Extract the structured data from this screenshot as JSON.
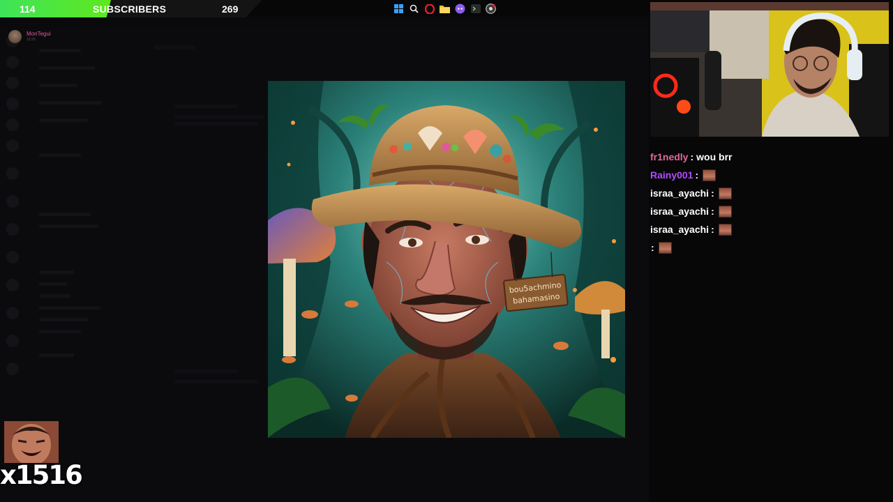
{
  "subscriber_bar": {
    "current": "114",
    "label": "SUBSCRIBERS",
    "goal": "269",
    "progress_fraction": 0.424,
    "fill_color": "#5ee81e"
  },
  "taskbar_icons": [
    "windows-icon",
    "search-icon",
    "opera-icon",
    "file-explorer-icon",
    "discord-icon",
    "terminal-icon",
    "obs-icon"
  ],
  "discord_user": {
    "name": "MonTegui",
    "time": "19:20"
  },
  "art_image": {
    "sign_line1": "bou5achmino",
    "sign_line2": "bahamasino"
  },
  "chat": {
    "messages": [
      {
        "user": "fr1nedly",
        "text": "wou brr",
        "emote": false,
        "color": "#e06a9a"
      },
      {
        "user": "Rainy001",
        "text": "",
        "emote": true,
        "color": "#b24cff"
      },
      {
        "user": "israa_ayachi",
        "text": "",
        "emote": true,
        "color": "#ffffff"
      },
      {
        "user": "israa_ayachi",
        "text": "",
        "emote": true,
        "color": "#ffffff"
      },
      {
        "user": "israa_ayachi",
        "text": "",
        "emote": true,
        "color": "#ffffff"
      },
      {
        "user": "",
        "text": "",
        "emote": true,
        "color": "#ffffff"
      }
    ]
  },
  "combo": {
    "count": "x1516"
  }
}
